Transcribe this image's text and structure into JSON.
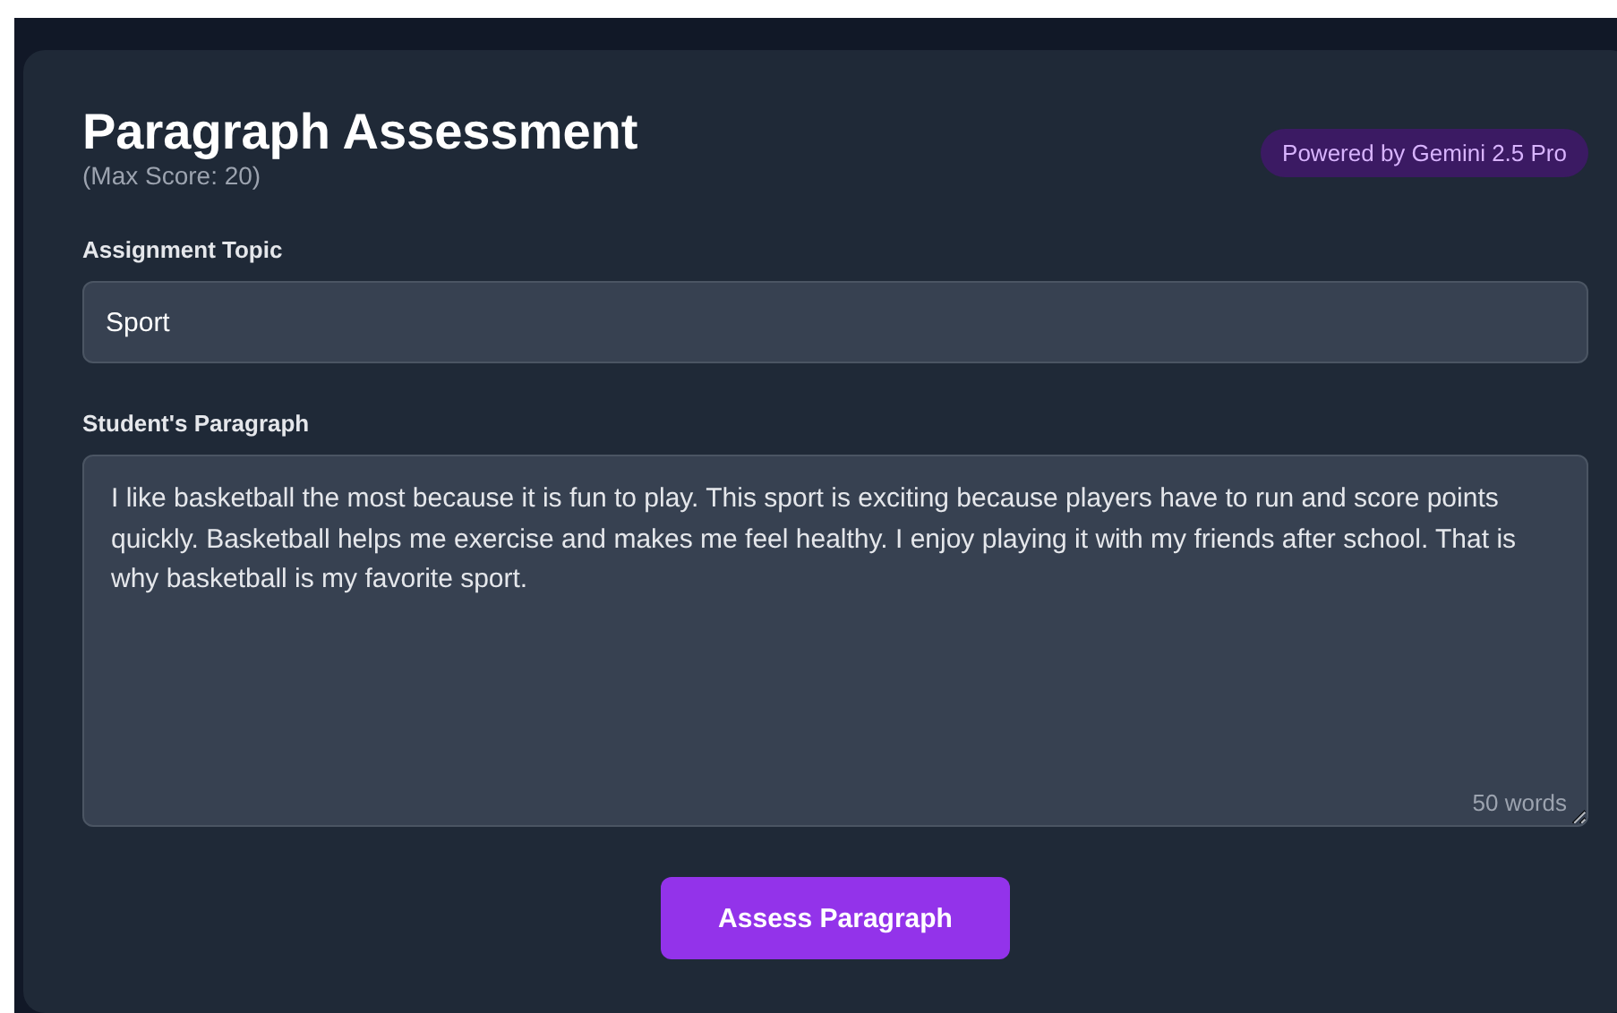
{
  "header": {
    "title": "Paragraph Assessment",
    "subtitle": "(Max Score: 20)",
    "badge": "Powered by Gemini 2.5 Pro"
  },
  "topic": {
    "label": "Assignment Topic",
    "value": "Sport"
  },
  "paragraph": {
    "label": "Student's Paragraph",
    "value": "I like basketball the most because it is fun to play. This sport is exciting because players have to run and score points quickly. Basketball helps me exercise and makes me feel healthy. I enjoy playing it with my friends after school. That is why basketball is my favorite sport.",
    "word_count": "50 words"
  },
  "submit": {
    "label": "Assess Paragraph"
  }
}
